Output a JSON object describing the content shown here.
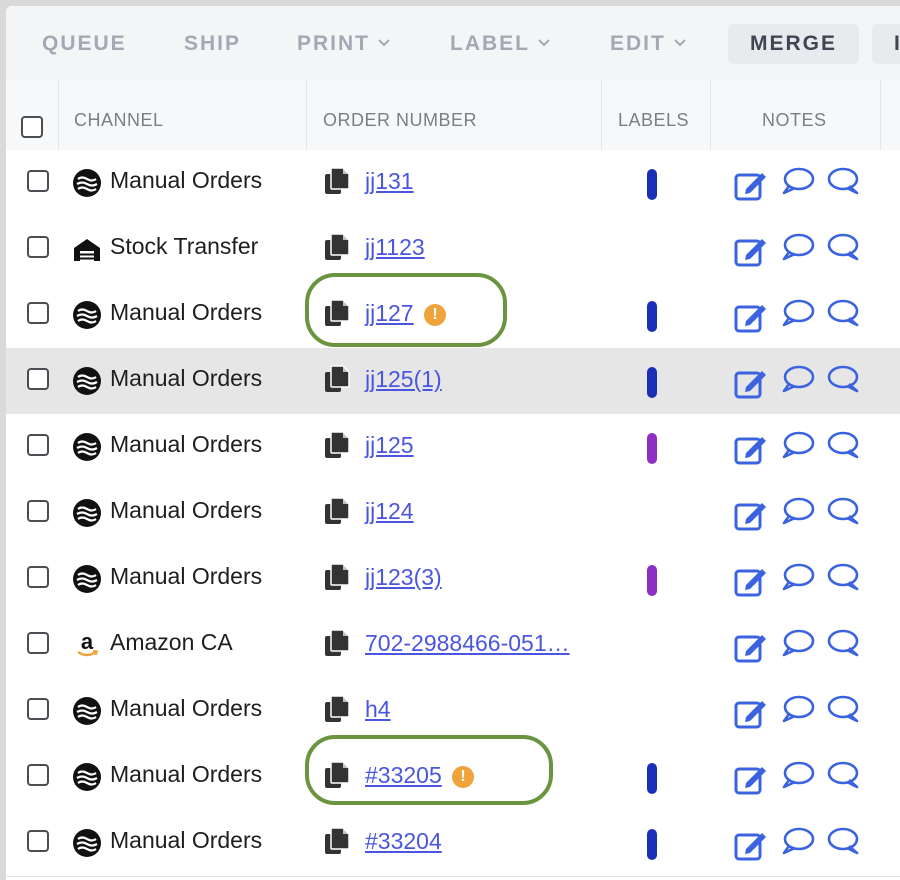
{
  "toolbar": {
    "queue": "QUEUE",
    "ship": "SHIP",
    "print": "PRINT",
    "label": "LABEL",
    "edit": "EDIT",
    "merge": "MERGE",
    "more": "I"
  },
  "table": {
    "columns": {
      "channel": "CHANNEL",
      "order_number": "ORDER NUMBER",
      "labels": "LABELS",
      "notes": "NOTES"
    },
    "rows": [
      {
        "channel": "Manual Orders",
        "channel_icon": "manual-orders-icon",
        "order": "jj131",
        "warning": false,
        "label_color": "#1a2fb5",
        "highlighted": false
      },
      {
        "channel": "Stock Transfer",
        "channel_icon": "warehouse-icon",
        "order": "jj1123",
        "warning": false,
        "label_color": null,
        "highlighted": false
      },
      {
        "channel": "Manual Orders",
        "channel_icon": "manual-orders-icon",
        "order": "jj127",
        "warning": true,
        "label_color": "#1a2fb5",
        "highlighted": false
      },
      {
        "channel": "Manual Orders",
        "channel_icon": "manual-orders-icon",
        "order": "jj125(1)",
        "warning": false,
        "label_color": "#1a2fb5",
        "highlighted": true
      },
      {
        "channel": "Manual Orders",
        "channel_icon": "manual-orders-icon",
        "order": "jj125",
        "warning": false,
        "label_color": "#8e2fc4",
        "highlighted": false
      },
      {
        "channel": "Manual Orders",
        "channel_icon": "manual-orders-icon",
        "order": "jj124",
        "warning": false,
        "label_color": null,
        "highlighted": false
      },
      {
        "channel": "Manual Orders",
        "channel_icon": "manual-orders-icon",
        "order": "jj123(3)",
        "warning": false,
        "label_color": "#8e2fc4",
        "highlighted": false
      },
      {
        "channel": "Amazon CA",
        "channel_icon": "amazon-icon",
        "order": "702-2988466-051…",
        "warning": false,
        "label_color": null,
        "highlighted": false
      },
      {
        "channel": "Manual Orders",
        "channel_icon": "manual-orders-icon",
        "order": "h4",
        "warning": false,
        "label_color": null,
        "highlighted": false
      },
      {
        "channel": "Manual Orders",
        "channel_icon": "manual-orders-icon",
        "order": "#33205",
        "warning": true,
        "label_color": "#1a2fb5",
        "highlighted": false
      },
      {
        "channel": "Manual Orders",
        "channel_icon": "manual-orders-icon",
        "order": "#33204",
        "warning": false,
        "label_color": "#1a2fb5",
        "highlighted": false
      }
    ],
    "warning_glyph": "!"
  },
  "colors": {
    "link": "#4a56e0",
    "warning": "#f0a23b",
    "callout": "#6b9440",
    "label_blue": "#1a2fb5",
    "label_purple": "#8e2fc4",
    "notes_icon": "#3b63e0"
  }
}
